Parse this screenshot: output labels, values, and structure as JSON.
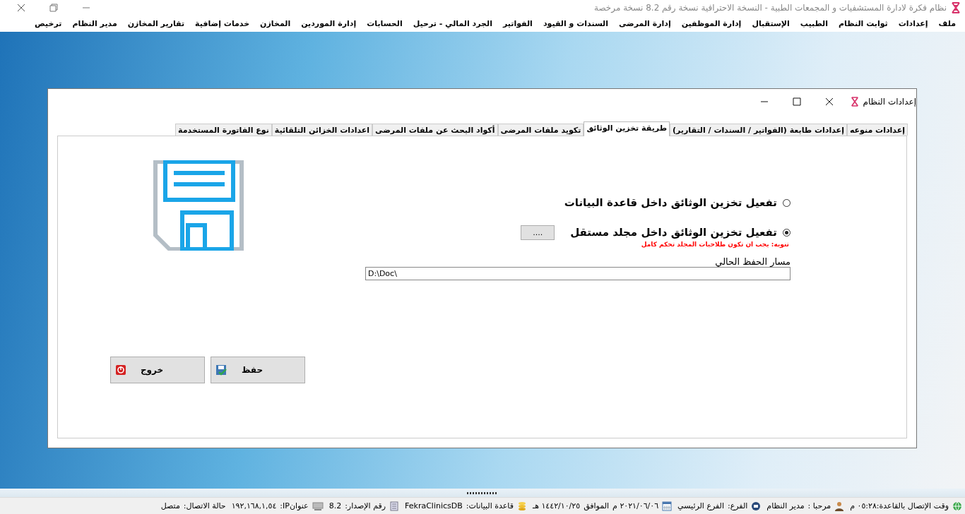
{
  "app_title": "نظام فكرة لادارة المستشفيات و المجمعات الطبية - النسخة الاحترافية نسخة رقم 8.2 نسخة مرخصة",
  "menu": [
    "ملف",
    "إعدادات",
    "ثوابت النظام",
    "الطبيب",
    "الإستقبال",
    "إدارة الموظفين",
    "إدارة المرضى",
    "السندات و القيود",
    "الفواتير",
    "الجرد المالي - ترحيل",
    "الحسابات",
    "إدارة الموردين",
    "المخازن",
    "خدمات إضافية",
    "تقارير المخازن",
    "مدير النظام",
    "ترخيص"
  ],
  "dialog": {
    "title": "إعدادات النظام",
    "tabs": [
      {
        "label": "إعدادات منوعه",
        "selected": false
      },
      {
        "label": "إعدادات طابعة (الفواتير / السندات / التقارير)",
        "selected": false
      },
      {
        "label": "طريقة تخزين الوثائق",
        "selected": true
      },
      {
        "label": "تكويد ملفات المرضى",
        "selected": false
      },
      {
        "label": "أكواد البحث عن ملفات المرضى",
        "selected": false
      },
      {
        "label": "اعدادات الخزائن التلقائية",
        "selected": false
      },
      {
        "label": "نوع الفاتورة المستخدمة",
        "selected": false
      }
    ],
    "options": [
      {
        "label": "تفعيل تخزين الوثائق داخل قاعدة البيانات",
        "selected": false
      },
      {
        "label": "تفعيل تخزين الوثائق داخل مجلد مستقل",
        "selected": true
      }
    ],
    "browse_button": "....",
    "warning": "تنويه: يجب ان تكون طلاحيات المجلد تحكم كامل",
    "path_label": "مسار الحفظ الحالي",
    "path_value": "D:\\Doc\\",
    "save_button": "حفظ",
    "exit_button": "خروج"
  },
  "status_bar": [
    [
      "وقت الإتصال بالقاعدة:٠٥:٢٨ م"
    ],
    [
      "مرحبا :",
      "مدير النظام"
    ],
    [
      "الفرع:",
      "الفرع الرئيسي"
    ],
    [
      "٢٠٢١/٠٦/٠٦ م",
      "الموافق",
      "١٤٤٢/١٠/٢٥ هـ"
    ],
    [
      "قاعدة البيانات:",
      "FekraClinicsDB"
    ],
    [
      "رقم الإصدار:",
      "8.2"
    ],
    [
      "عنوانIP:",
      "١٩٢,١٦٨,١,٥٤"
    ],
    [
      "حالة الاتصال:",
      "متصل"
    ]
  ]
}
